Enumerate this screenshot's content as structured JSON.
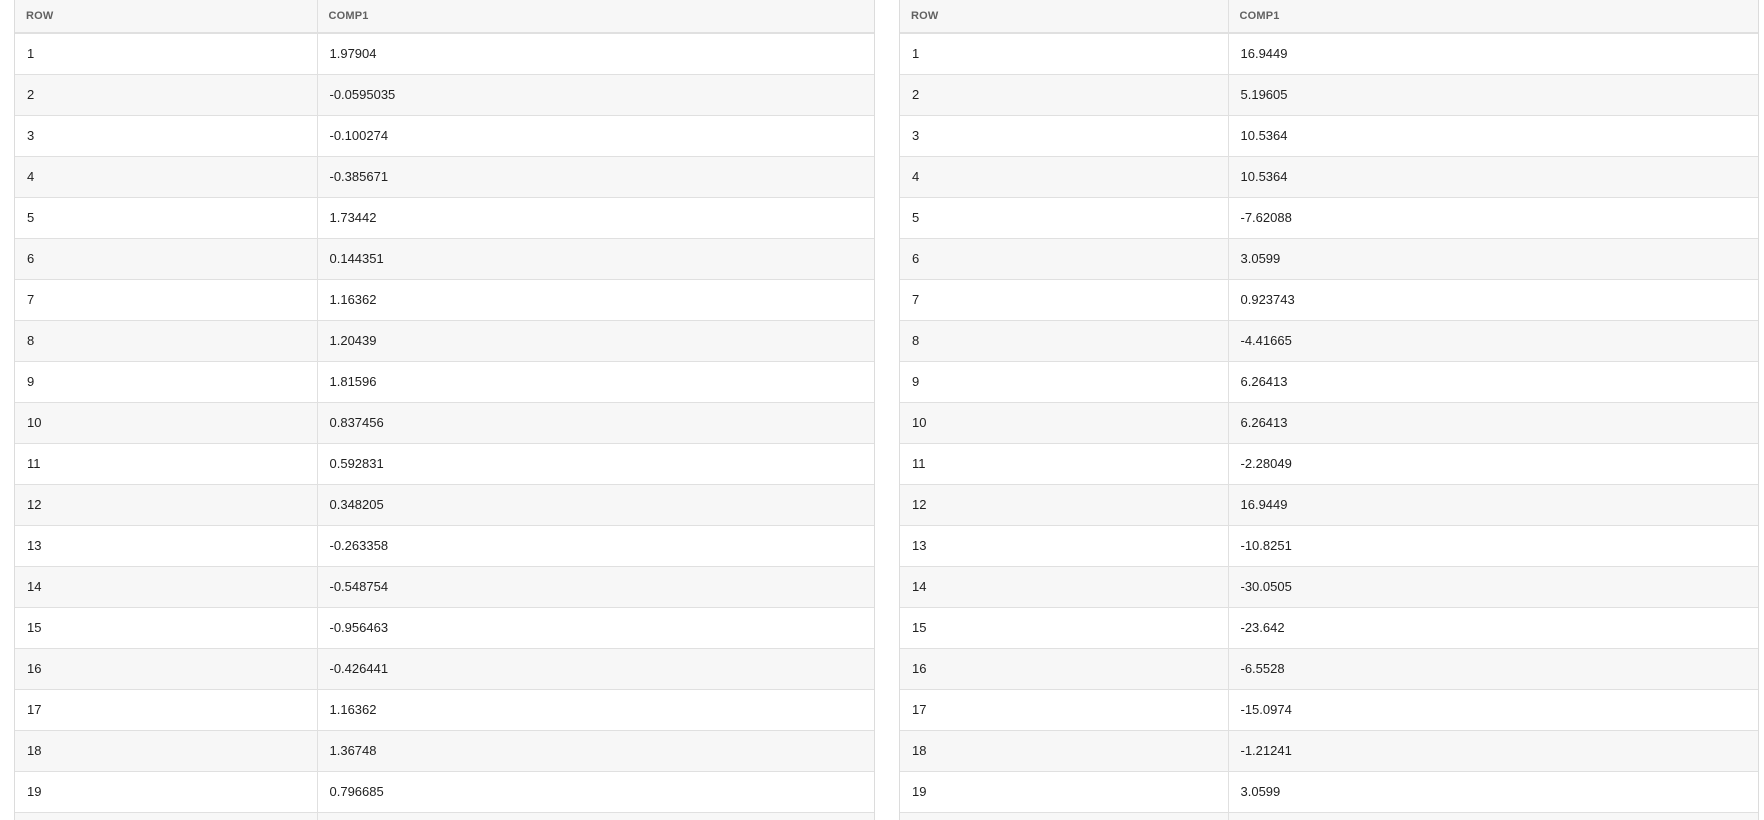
{
  "left_table": {
    "columns": [
      "ROW",
      "COMP1"
    ],
    "rows": [
      [
        "1",
        "1.97904"
      ],
      [
        "2",
        "-0.0595035"
      ],
      [
        "3",
        "-0.100274"
      ],
      [
        "4",
        "-0.385671"
      ],
      [
        "5",
        "1.73442"
      ],
      [
        "6",
        "0.144351"
      ],
      [
        "7",
        "1.16362"
      ],
      [
        "8",
        "1.20439"
      ],
      [
        "9",
        "1.81596"
      ],
      [
        "10",
        "0.837456"
      ],
      [
        "11",
        "0.592831"
      ],
      [
        "12",
        "0.348205"
      ],
      [
        "13",
        "-0.263358"
      ],
      [
        "14",
        "-0.548754"
      ],
      [
        "15",
        "-0.956463"
      ],
      [
        "16",
        "-0.426441"
      ],
      [
        "17",
        "1.16362"
      ],
      [
        "18",
        "1.36748"
      ],
      [
        "19",
        "0.796685"
      ],
      [
        "",
        ""
      ]
    ]
  },
  "right_table": {
    "columns": [
      "ROW",
      "COMP1"
    ],
    "rows": [
      [
        "1",
        "16.9449"
      ],
      [
        "2",
        "5.19605"
      ],
      [
        "3",
        "10.5364"
      ],
      [
        "4",
        "10.5364"
      ],
      [
        "5",
        "-7.62088"
      ],
      [
        "6",
        "3.0599"
      ],
      [
        "7",
        "0.923743"
      ],
      [
        "8",
        "-4.41665"
      ],
      [
        "9",
        "6.26413"
      ],
      [
        "10",
        "6.26413"
      ],
      [
        "11",
        "-2.28049"
      ],
      [
        "12",
        "16.9449"
      ],
      [
        "13",
        "-10.8251"
      ],
      [
        "14",
        "-30.0505"
      ],
      [
        "15",
        "-23.642"
      ],
      [
        "16",
        "-6.5528"
      ],
      [
        "17",
        "-15.0974"
      ],
      [
        "18",
        "-1.21241"
      ],
      [
        "19",
        "3.0599"
      ],
      [
        "",
        ""
      ]
    ]
  }
}
